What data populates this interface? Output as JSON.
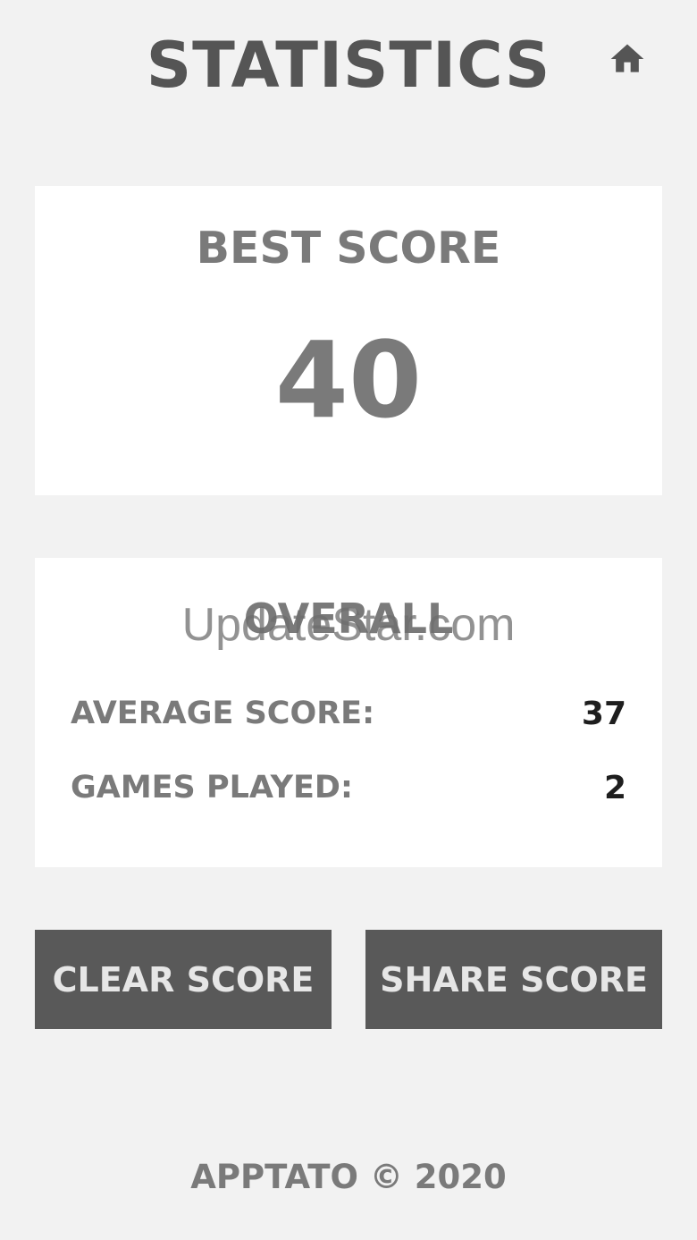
{
  "header": {
    "title": "STATISTICS",
    "home_icon": "home-icon"
  },
  "best_score": {
    "label": "BEST SCORE",
    "value": "40"
  },
  "overall": {
    "label": "OVERALL",
    "rows": [
      {
        "label": "AVERAGE SCORE:",
        "value": "37"
      },
      {
        "label": "GAMES PLAYED:",
        "value": "2"
      }
    ]
  },
  "buttons": {
    "clear": "CLEAR SCORE",
    "share": "SHARE SCORE"
  },
  "watermark": "UpdateStar.com",
  "footer": "APPTATO © 2020",
  "colors": {
    "background": "#f2f2f2",
    "card": "#ffffff",
    "button": "#595959",
    "text_muted": "#7a7a7a",
    "text_dark": "#1e1e1e"
  }
}
